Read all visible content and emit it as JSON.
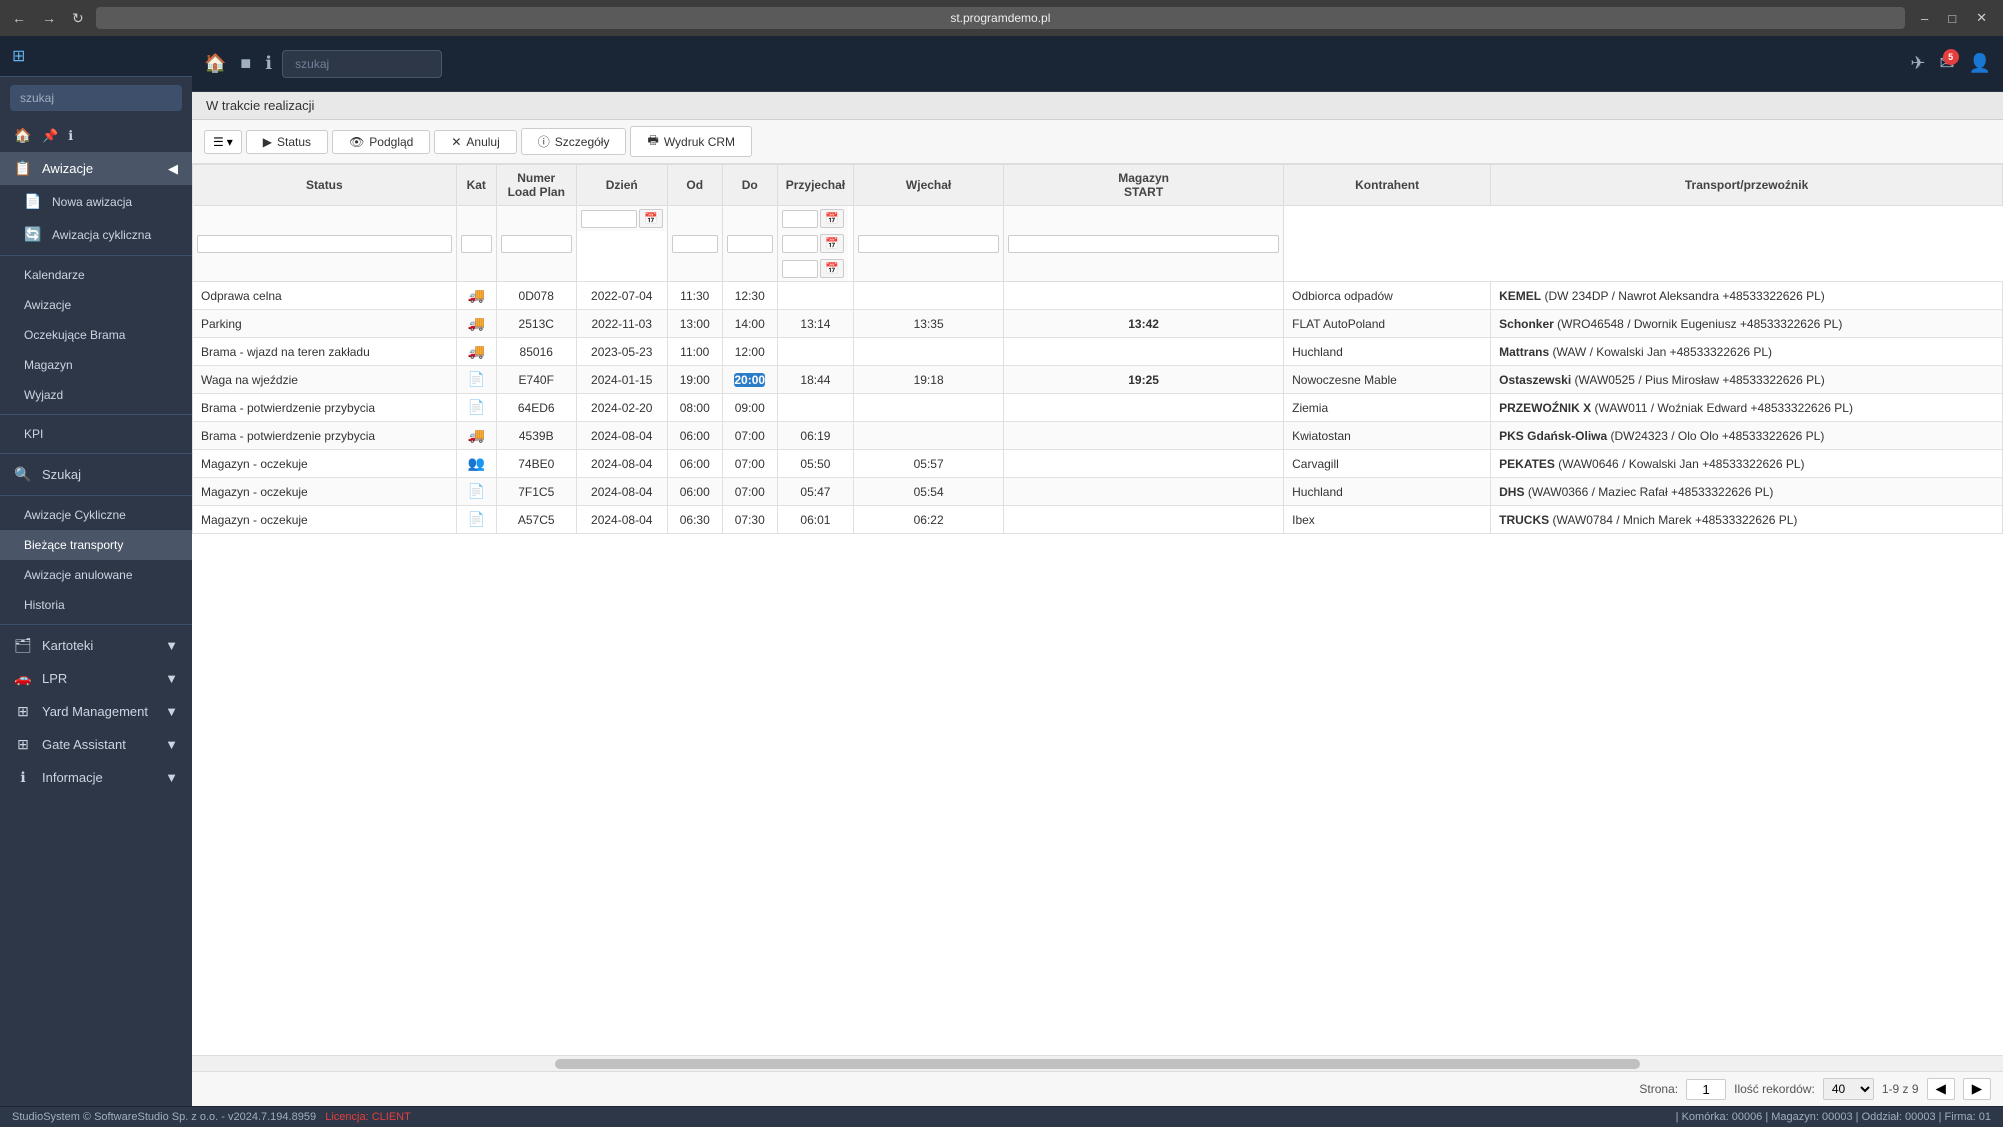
{
  "browser": {
    "address": "st.programdemo.pl",
    "title": "st.programdemo.pl"
  },
  "topbar": {
    "search_placeholder": "szukaj",
    "notification_count": "5"
  },
  "sidebar": {
    "logo_icon": "⊞",
    "sections": [
      {
        "items": [
          {
            "id": "home",
            "label": "",
            "icon": "🏠"
          },
          {
            "id": "awizacje",
            "label": "Awizacje",
            "icon": "📋",
            "active": true,
            "has_arrow": true
          }
        ]
      },
      {
        "sub_items": [
          {
            "id": "nowa-awizacja",
            "label": "Nowa awizacja",
            "icon": "📄"
          },
          {
            "id": "awizacja-cykliczna",
            "label": "Awizacja cykliczna",
            "icon": "🔄"
          }
        ]
      },
      {
        "items": [
          {
            "id": "kalendarze",
            "label": "Kalendarze",
            "icon": ""
          },
          {
            "id": "awizacje2",
            "label": "Awizacje",
            "icon": ""
          },
          {
            "id": "oczekujace-brama",
            "label": "Oczekujące Brama",
            "icon": ""
          },
          {
            "id": "magazyn",
            "label": "Magazyn",
            "icon": ""
          },
          {
            "id": "wyjazd",
            "label": "Wyjazd",
            "icon": ""
          }
        ]
      },
      {
        "items": [
          {
            "id": "kpi",
            "label": "KPI",
            "icon": ""
          }
        ]
      },
      {
        "items": [
          {
            "id": "szukaj",
            "label": "Szukaj",
            "icon": "🔍"
          }
        ]
      },
      {
        "items": [
          {
            "id": "awizacje-cykliczne",
            "label": "Awizacje Cykliczne",
            "icon": ""
          },
          {
            "id": "biezace-transporty",
            "label": "Bieżące transporty",
            "icon": "",
            "active": true
          },
          {
            "id": "awizacje-anulowane",
            "label": "Awizacje anulowane",
            "icon": ""
          },
          {
            "id": "historia",
            "label": "Historia",
            "icon": ""
          }
        ]
      },
      {
        "items": [
          {
            "id": "kartoteki",
            "label": "Kartoteki",
            "icon": "🗂",
            "has_arrow": true
          }
        ]
      },
      {
        "items": [
          {
            "id": "lpr",
            "label": "LPR",
            "icon": "🚗",
            "has_arrow": true
          }
        ]
      },
      {
        "items": [
          {
            "id": "yard-management",
            "label": "Yard Management",
            "icon": "⊞",
            "has_arrow": true
          }
        ]
      },
      {
        "items": [
          {
            "id": "gate-assistant",
            "label": "Gate Assistant",
            "icon": "⊞",
            "has_arrow": true
          }
        ]
      },
      {
        "items": [
          {
            "id": "informacje",
            "label": "Informacje",
            "icon": "ℹ",
            "has_arrow": true
          }
        ]
      }
    ]
  },
  "page": {
    "title": "W trakcie realizacji",
    "toolbar": {
      "menu_btn": "☰",
      "menu_arrow": "▾",
      "status_label": "Status",
      "podglad_label": "Podgląd",
      "anuluj_label": "Anuluj",
      "szczegoly_label": "Szczegóły",
      "wydruk_crm_label": "Wydruk CRM"
    }
  },
  "table": {
    "headers": [
      {
        "id": "status",
        "label": "Status"
      },
      {
        "id": "kat",
        "label": "Kat"
      },
      {
        "id": "numer",
        "label": "Numer\nLoad Plan"
      },
      {
        "id": "dzien",
        "label": "Dzień"
      },
      {
        "id": "od",
        "label": "Od"
      },
      {
        "id": "do",
        "label": "Do"
      },
      {
        "id": "przyjachal",
        "label": "Przyjechał"
      },
      {
        "id": "wjechal",
        "label": "Wjechał"
      },
      {
        "id": "magazyn",
        "label": "Magazyn\nSTART"
      },
      {
        "id": "kontrahent",
        "label": "Kontrahent"
      },
      {
        "id": "transport",
        "label": "Transport/przewoźnik"
      }
    ],
    "rows": [
      {
        "status": "Odprawa celna",
        "kat_icon": "truck",
        "numer": "0D078",
        "dzien": "2022-07-04",
        "od": "11:30",
        "do": "12:30",
        "przyjachal": "",
        "wjechal": "",
        "magazyn": "",
        "kontrahent": "Odbiorca odpadów",
        "transport_bold": "KEMEL",
        "transport_rest": " (DW 234DP / Nawrot Aleksandra +48533322626 PL)"
      },
      {
        "status": "Parking",
        "kat_icon": "truck",
        "numer": "2513C",
        "dzien": "2022-11-03",
        "od": "13:00",
        "do": "14:00",
        "przyjachal": "13:14",
        "wjechal": "13:35",
        "magazyn": "13:42",
        "magazyn_bold": true,
        "kontrahent": "FLAT AutoPoland",
        "transport_bold": "Schonker",
        "transport_rest": " (WRO46548 / Dwornik Eugeniusz +48533322626 PL)"
      },
      {
        "status": "Brama - wjazd na teren zakładu",
        "kat_icon": "truck",
        "numer": "85016",
        "dzien": "2023-05-23",
        "od": "11:00",
        "do": "12:00",
        "przyjachal": "",
        "wjechal": "",
        "magazyn": "",
        "kontrahent": "Huchland",
        "transport_bold": "Mattrans",
        "transport_rest": " (WAW / Kowalski Jan +48533322626 PL)"
      },
      {
        "status": "Waga na wjeździe",
        "kat_icon": "doc-red",
        "numer": "E740F",
        "dzien": "2024-01-15",
        "od": "19:00",
        "do": "20:00",
        "do_highlight": true,
        "przyjachal": "18:44",
        "wjechal": "19:18",
        "magazyn": "19:25",
        "magazyn_bold": true,
        "kontrahent": "Nowoczesne Mable",
        "transport_bold": "Ostaszewski",
        "transport_rest": " (WAW0525 / Pius Mirosław +48533322626 PL)"
      },
      {
        "status": "Brama - potwierdzenie przybycia",
        "kat_icon": "doc-red",
        "numer": "64ED6",
        "dzien": "2024-02-20",
        "od": "08:00",
        "do": "09:00",
        "przyjachal": "",
        "wjechal": "",
        "magazyn": "",
        "kontrahent": "Ziemia",
        "transport_bold": "PRZEWOŹNIK X",
        "transport_rest": " (WAW011 / Woźniak Edward +48533322626 PL)"
      },
      {
        "status": "Brama - potwierdzenie przybycia",
        "kat_icon": "truck",
        "numer": "4539B",
        "dzien": "2024-08-04",
        "od": "06:00",
        "do": "07:00",
        "przyjachal": "06:19",
        "wjechal": "",
        "magazyn": "",
        "kontrahent": "Kwiatostan",
        "transport_bold": "PKS Gdańsk-Oliwa",
        "transport_rest": " (DW24323 / Olo Olo +48533322626 PL)"
      },
      {
        "status": "Magazyn - oczekuje",
        "kat_icon": "people",
        "numer": "74BE0",
        "dzien": "2024-08-04",
        "od": "06:00",
        "do": "07:00",
        "przyjachal": "05:50",
        "wjechal": "05:57",
        "magazyn": "",
        "kontrahent": "Carvagill",
        "transport_bold": "PEKATES",
        "transport_rest": " (WAW0646 / Kowalski Jan +48533322626 PL)"
      },
      {
        "status": "Magazyn - oczekuje",
        "kat_icon": "doc-green",
        "numer": "7F1C5",
        "dzien": "2024-08-04",
        "od": "06:00",
        "do": "07:00",
        "przyjachal": "05:47",
        "wjechal": "05:54",
        "magazyn": "",
        "kontrahent": "Huchland",
        "transport_bold": "DHS",
        "transport_rest": " (WAW0366 / Maziec Rafał +48533322626 PL)"
      },
      {
        "status": "Magazyn - oczekuje",
        "kat_icon": "doc-red",
        "numer": "A57C5",
        "dzien": "2024-08-04",
        "od": "06:30",
        "do": "07:30",
        "przyjachal": "06:01",
        "wjechal": "06:22",
        "magazyn": "",
        "kontrahent": "Ibex",
        "transport_bold": "TRUCKS",
        "transport_rest": " (WAW0784 / Mnich Marek +48533322626 PL)"
      }
    ]
  },
  "pagination": {
    "page_label": "Strona:",
    "page_value": "1",
    "records_label": "Ilość rekordów:",
    "records_value": "40",
    "range": "1-9 z 9"
  },
  "status_bar": {
    "copyright": "StudioSystem © SoftwareStudio Sp. z o.o. - v2024.7.194.8959",
    "license": "Licencja: CLIENT",
    "right": "| Komórka: 00006 | Magazyn: 00003 | Oddział: 00003 | Firma: 01"
  }
}
